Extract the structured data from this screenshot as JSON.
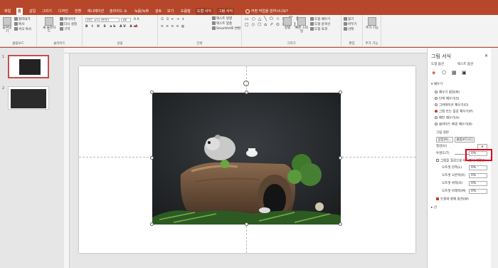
{
  "tabs": [
    "파일",
    "홈",
    "삽입",
    "그리기",
    "디자인",
    "전환",
    "애니메이션",
    "슬라이드 쇼",
    "녹음/녹화",
    "검토",
    "보기",
    "도움말",
    "도형 서식",
    "그림 서식"
  ],
  "active_tab": "홈",
  "tell_me": "어떤 작업을 원하시나요?",
  "ribbon": {
    "clipboard": {
      "paste": "붙여넣기",
      "cut": "잘라내기",
      "copy": "복사",
      "format_painter": "서식 복사",
      "label": "클립보드"
    },
    "slides": {
      "new_slide": "새 슬라이드",
      "layout": "레이아웃",
      "reset": "다시 설정",
      "section": "구역",
      "label": "슬라이드"
    },
    "font": {
      "name": "맑은 고딕 (본문)",
      "size": "18",
      "label": "글꼴"
    },
    "paragraph": {
      "label": "단락",
      "direction": "텍스트 방향",
      "align": "텍스트 맞춤",
      "smartart": "SmartArt로 변환"
    },
    "drawing": {
      "label": "그리기",
      "arrange": "정렬",
      "quick_styles": "빠른 스타일",
      "fill": "도형 채우기",
      "outline": "도형 윤곽선",
      "effects": "도형 효과"
    },
    "editing": {
      "label": "편집",
      "find": "찾기",
      "replace": "바꾸기",
      "select": "선택"
    },
    "addins": {
      "label": "추가 기능",
      "btn": "추가 기능"
    }
  },
  "slides": [
    {
      "num": "1"
    },
    {
      "num": "2"
    }
  ],
  "pane": {
    "title": "그림 서식",
    "subtabs": [
      "도형 옵션",
      "텍스트 옵션"
    ],
    "section_fill": "채우기",
    "fill_options": [
      "채우기 없음(N)",
      "단색 채우기(S)",
      "그라데이션 채우기(G)",
      "그림 또는 질감 채우기(P)",
      "패턴 채우기(A)",
      "슬라이드 배경 채우기(B)"
    ],
    "selected_fill": 3,
    "picture_source": "그림 원본",
    "insert_btn": "삽입(R)...",
    "clipboard_btn": "클립보드(C)",
    "texture": "질감(U)",
    "transparency": "투명도(T)",
    "transparency_value": "0%",
    "tile_label": "그림을 질감으로 바둑판식 배열(I)",
    "offsets": [
      {
        "label": "오프셋 왼쪽(L)",
        "value": "0%"
      },
      {
        "label": "오프셋 오른쪽(R)",
        "value": "0%"
      },
      {
        "label": "오프셋 위쪽(O)",
        "value": "0%"
      },
      {
        "label": "오프셋 아래쪽(M)",
        "value": "0%"
      }
    ],
    "rotate_with_shape": "도형과 함께 회전(W)",
    "section_line": "선"
  }
}
